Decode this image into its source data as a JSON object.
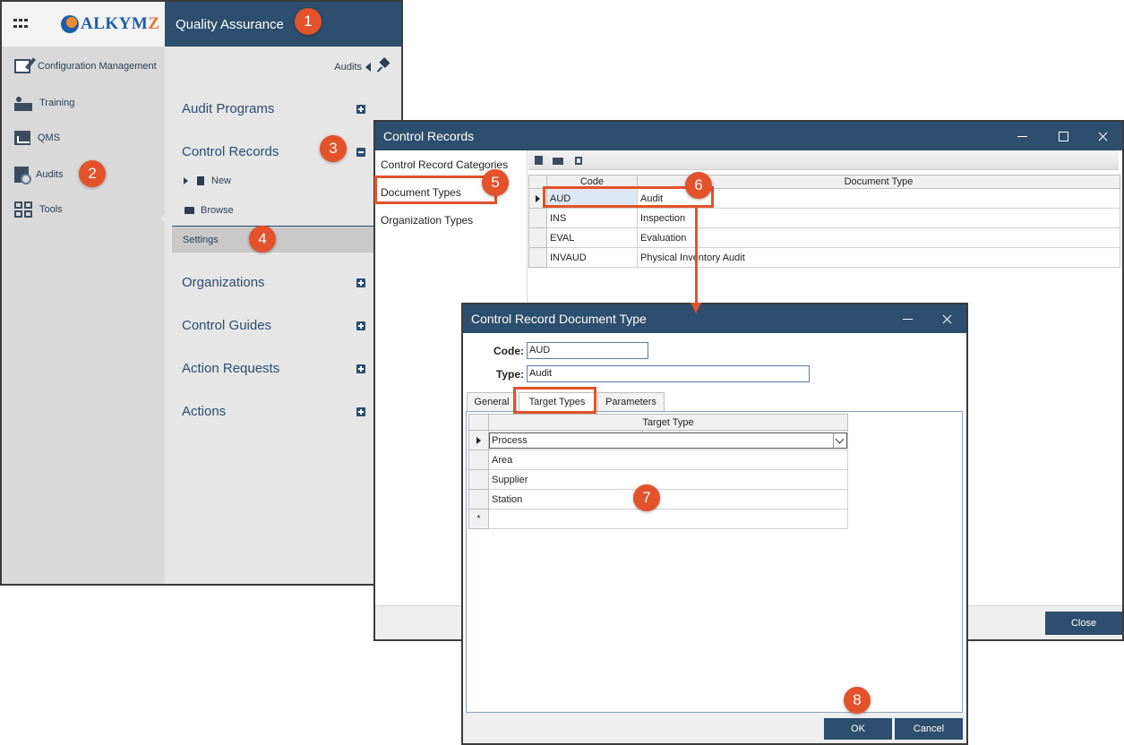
{
  "app": {
    "logo_text": "ALKYMZ",
    "title": "Quality Assurance",
    "nav": [
      {
        "label": "Configuration Management",
        "icon": "config-edit-icon"
      },
      {
        "label": "Training",
        "icon": "training-icon"
      },
      {
        "label": "QMS",
        "icon": "qms-icon"
      },
      {
        "label": "Audits",
        "icon": "audits-icon"
      },
      {
        "label": "Tools",
        "icon": "tools-icon"
      }
    ],
    "panel": {
      "breadcrumb": "Audits",
      "sections": {
        "audit_programs": "Audit Programs",
        "control_records": "Control Records",
        "organizations": "Organizations",
        "control_guides": "Control Guides",
        "action_requests": "Action Requests",
        "actions": "Actions"
      },
      "sub": {
        "new": "New",
        "browse": "Browse",
        "settings": "Settings"
      }
    }
  },
  "control_records": {
    "title": "Control Records",
    "categories": [
      "Control Record Categories",
      "Document Types",
      "Organization Types"
    ],
    "columns": [
      "Code",
      "Document Type"
    ],
    "rows": [
      {
        "code": "AUD",
        "type": "Audit"
      },
      {
        "code": "INS",
        "type": "Inspection"
      },
      {
        "code": "EVAL",
        "type": "Evaluation"
      },
      {
        "code": "INVAUD",
        "type": "Physical Inventory Audit"
      }
    ],
    "close_label": "Close"
  },
  "doc_type_dialog": {
    "title": "Control Record Document Type",
    "code_label": "Code",
    "code_value": "AUD",
    "type_label": "Type",
    "type_value": "Audit",
    "tabs": [
      "General",
      "Target Types",
      "Parameters"
    ],
    "active_tab": "Target Types",
    "grid_header": "Target Type",
    "target_types": [
      "Process",
      "Area",
      "Supplier",
      "Station"
    ],
    "new_row_marker": "*",
    "ok_label": "OK",
    "cancel_label": "Cancel"
  },
  "annotations": [
    "1",
    "2",
    "3",
    "4",
    "5",
    "6",
    "7",
    "8"
  ],
  "colors": {
    "header_blue": "#2d4e6e",
    "accent_orange": "#e3522b",
    "nav_gray": "#d9d9d9",
    "panel_gray": "#e6e6e6"
  }
}
